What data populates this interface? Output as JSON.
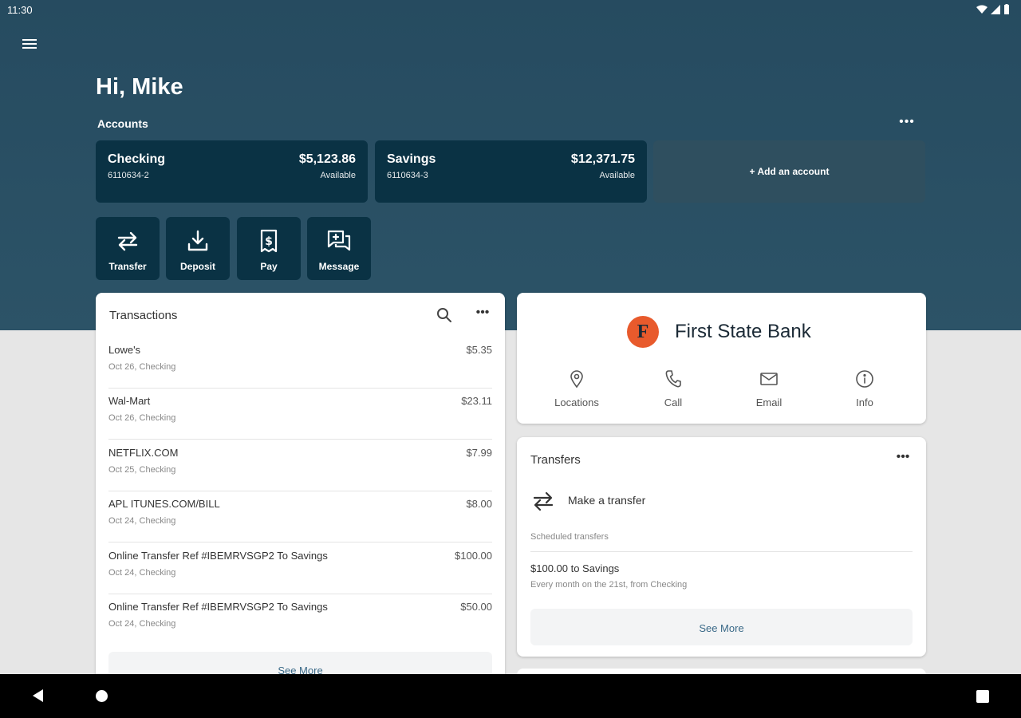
{
  "status_bar": {
    "time": "11:30"
  },
  "greeting": "Hi, Mike",
  "accounts": {
    "label": "Accounts",
    "items": [
      {
        "name": "Checking",
        "number": "6110634-2",
        "balance": "$5,123.86",
        "balance_label": "Available"
      },
      {
        "name": "Savings",
        "number": "6110634-3",
        "balance": "$12,371.75",
        "balance_label": "Available"
      }
    ],
    "add_label": "+ Add an account"
  },
  "quick_actions": [
    {
      "label": "Transfer",
      "icon": "transfer-icon"
    },
    {
      "label": "Deposit",
      "icon": "deposit-icon"
    },
    {
      "label": "Pay",
      "icon": "pay-icon"
    },
    {
      "label": "Message",
      "icon": "message-icon"
    }
  ],
  "transactions": {
    "title": "Transactions",
    "rows": [
      {
        "name": "Lowe's",
        "sub": "Oct 26, Checking",
        "amount": "$5.35"
      },
      {
        "name": "Wal-Mart",
        "sub": "Oct 26, Checking",
        "amount": "$23.11"
      },
      {
        "name": "NETFLIX.COM",
        "sub": "Oct 25, Checking",
        "amount": "$7.99"
      },
      {
        "name": "APL ITUNES.COM/BILL",
        "sub": "Oct 24, Checking",
        "amount": "$8.00"
      },
      {
        "name": "Online Transfer Ref #IBEMRVSGP2 To Savings",
        "sub": "Oct 24, Checking",
        "amount": "$100.00"
      },
      {
        "name": "Online Transfer Ref #IBEMRVSGP2 To Savings",
        "sub": "Oct 24, Checking",
        "amount": "$50.00"
      }
    ],
    "see_more": "See More"
  },
  "bank": {
    "logo_letter": "F",
    "name": "First State Bank",
    "logo_color": "#e85a2c",
    "actions": [
      {
        "label": "Locations",
        "icon": "location-pin-icon"
      },
      {
        "label": "Call",
        "icon": "phone-icon"
      },
      {
        "label": "Email",
        "icon": "email-icon"
      },
      {
        "label": "Info",
        "icon": "info-icon"
      }
    ]
  },
  "transfers": {
    "title": "Transfers",
    "make_transfer": "Make a transfer",
    "scheduled_label": "Scheduled transfers",
    "scheduled": [
      {
        "title": "$100.00 to Savings",
        "sub": "Every month on the 21st, from Checking"
      }
    ],
    "see_more": "See More"
  },
  "colors": {
    "hero": "#264b60",
    "card_dark": "#0a3244",
    "link": "#3b6a88"
  }
}
